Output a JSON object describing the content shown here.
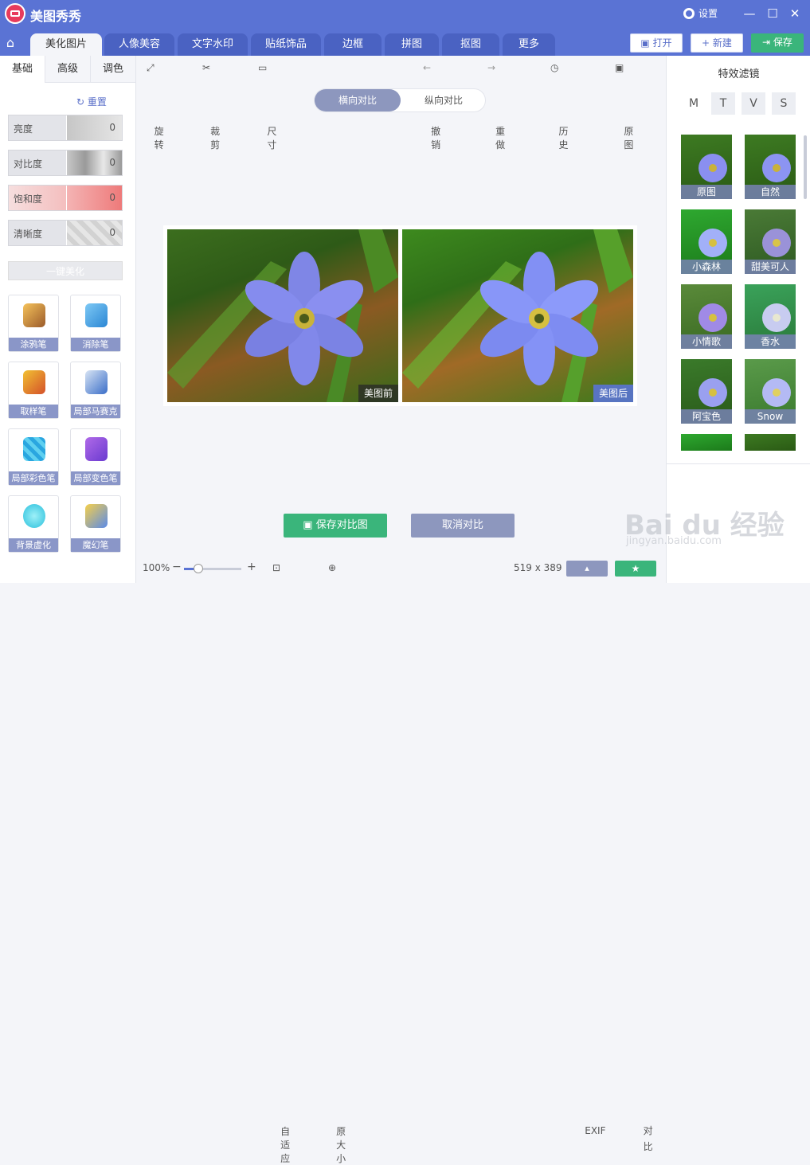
{
  "app": {
    "title": "美图秀秀",
    "settings": "设置"
  },
  "window": {
    "minimize": "—",
    "maximize": "☐",
    "close": "✕"
  },
  "tabs": [
    "美化图片",
    "人像美容",
    "文字水印",
    "贴纸饰品",
    "边框",
    "拼图",
    "抠图",
    "更多"
  ],
  "actions": {
    "open": "打开",
    "new": "新建",
    "save": "保存"
  },
  "left": {
    "subtabs": [
      "基础",
      "高级",
      "调色"
    ],
    "reset": "重置",
    "sliders": [
      {
        "label": "亮度",
        "value": "0",
        "color": "#bdbdbd"
      },
      {
        "label": "对比度",
        "value": "0",
        "color": "#b0b0b0"
      },
      {
        "label": "饱和度",
        "value": "0",
        "color": "#f08a8a"
      },
      {
        "label": "清晰度",
        "value": "0",
        "color": "#dcdcdc"
      }
    ],
    "onekey": "一键美化",
    "tools": [
      "涂鸦笔",
      "消除笔",
      "取样笔",
      "局部马赛克",
      "局部彩色笔",
      "局部变色笔",
      "背景虚化",
      "魔幻笔"
    ]
  },
  "toolbar": {
    "rotate": "旋转",
    "crop": "裁剪",
    "size": "尺寸",
    "undo": "撤销",
    "redo": "重做",
    "history": "历史",
    "original": "原图"
  },
  "compare": {
    "horizontal": "横向对比",
    "vertical": "纵向对比",
    "before": "美图前",
    "after": "美图后",
    "save": "保存对比图",
    "cancel": "取消对比"
  },
  "status": {
    "zoom": "100%",
    "zoom_level": 0.25,
    "fit": "自适应",
    "original_size": "原大小",
    "dimensions": "519 x 389",
    "exif": "EXIF",
    "compare": "对比"
  },
  "right": {
    "title": "特效滤镜",
    "letters": [
      "M",
      "T",
      "V",
      "S"
    ],
    "filters": [
      "原图",
      "自然",
      "小森林",
      "甜美可人",
      "小情歌",
      "香水",
      "阿宝色",
      "Snow"
    ]
  },
  "watermark": {
    "main": "Bai du 经验",
    "sub": "jingyan.baidu.com"
  }
}
